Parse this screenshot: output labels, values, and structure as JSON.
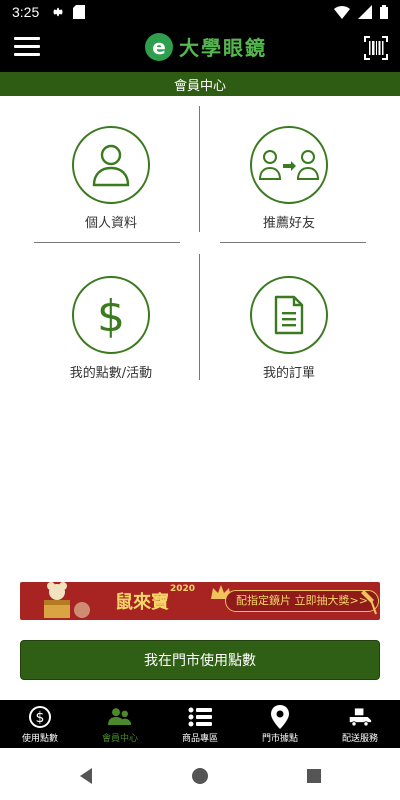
{
  "status": {
    "time": "3:25"
  },
  "header": {
    "logo_letter": "e",
    "brand": "大學眼鏡"
  },
  "title_bar": {
    "title": "會員中心"
  },
  "tiles": [
    {
      "label": "個人資料",
      "icon": "person-icon"
    },
    {
      "label": "推薦好友",
      "icon": "refer-friend-icon"
    },
    {
      "label": "我的點數/活動",
      "icon": "dollar-icon"
    },
    {
      "label": "我的訂單",
      "icon": "document-icon"
    }
  ],
  "banner": {
    "headline": "鼠來寶",
    "year": "2020",
    "cta": "配指定鏡片 立即抽大獎>>"
  },
  "primary_button": {
    "label": "我在門市使用點數"
  },
  "bottom_nav": [
    {
      "label": "使用點數",
      "icon": "dollar-circle-icon",
      "active": false
    },
    {
      "label": "會員中心",
      "icon": "members-icon",
      "active": true
    },
    {
      "label": "商品專區",
      "icon": "list-icon",
      "active": false
    },
    {
      "label": "門市據點",
      "icon": "location-pin-icon",
      "active": false
    },
    {
      "label": "配送服務",
      "icon": "delivery-truck-icon",
      "active": false
    }
  ],
  "colors": {
    "brand_green": "#2e5c13",
    "accent_green": "#55b84e",
    "banner_red": "#a72422",
    "gold": "#f7d568"
  }
}
